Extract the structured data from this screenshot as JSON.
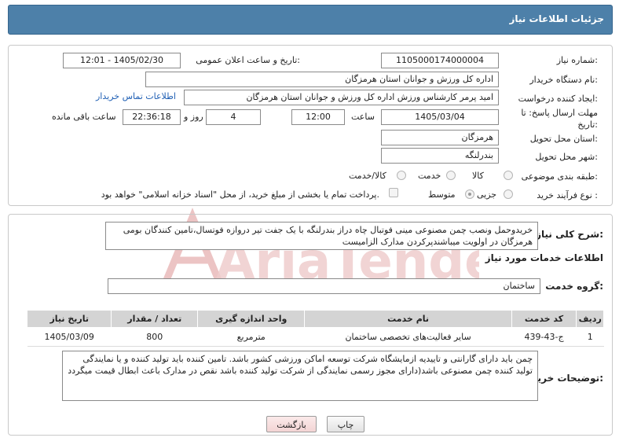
{
  "header": {
    "title": "جزئیات اطلاعات نیاز"
  },
  "form": {
    "need_number_label": "شماره نیاز:",
    "need_number": "1105000174000004",
    "announce_label": "تاریخ و ساعت اعلان عمومی:",
    "announce_value": "1405/02/30 - 12:01",
    "buyer_org_label": "نام دستگاه خریدار:",
    "buyer_org": "اداره کل ورزش و جوانان استان هرمزگان",
    "creator_label": "ایجاد کننده درخواست:",
    "creator": "امید پرمر کارشناس ورزش اداره کل ورزش و جوانان استان هرمزگان",
    "contact_link": "اطلاعات تماس خریدار",
    "deadline_label_1": "مهلت ارسال پاسخ: تا",
    "deadline_label_2": "تاریخ:",
    "deadline_date": "1405/03/04",
    "time_label": "ساعت",
    "deadline_time": "12:00",
    "days_value": "4",
    "days_label": "روز و",
    "remaining_time": "22:36:18",
    "remaining_label": "ساعت باقی مانده",
    "province_label": "استان محل تحویل:",
    "province": "هرمزگان",
    "city_label": "شهر محل تحویل:",
    "city": "بندرلنگه",
    "category_label": "طبقه بندی موضوعی:",
    "category_options": [
      "کالا",
      "خدمت",
      "کالا/خدمت"
    ],
    "process_label": "نوع فرآیند خرید :",
    "process_options": [
      "جزیی",
      "متوسط"
    ],
    "payment_note": "پرداخت تمام یا بخشی از مبلغ خرید، از محل \"اسناد خزانه اسلامی\" خواهد بود."
  },
  "description": {
    "label": "شرح کلی نیاز:",
    "text": "خریدوحمل ونصب چمن مصنوعی مینی فوتبال چاه دراز بندرلنگه با یک جفت تیر دروازه فوتسال،تامین کنندگان بومی هرمزگان در اولویت میباشندپرکردن مدارک الزامیست"
  },
  "services": {
    "section_title": "اطلاعات خدمات مورد نیاز",
    "group_label": "گروه خدمت:",
    "group_value": "ساختمان",
    "columns": [
      "ردیف",
      "کد خدمت",
      "نام خدمت",
      "واحد اندازه گیری",
      "تعداد / مقدار",
      "تاریخ نیاز"
    ],
    "rows": [
      [
        "1",
        "ج-43-439",
        "سایر فعالیت‌های تخصصی ساختمان",
        "مترمربع",
        "800",
        "1405/03/09"
      ]
    ]
  },
  "buyer_notes": {
    "label": "توضیحات خریدار:",
    "text": "چمن باید دارای گارانتی و تاییدیه ازمایشگاه شرکت توسعه اماکن ورزشی کشور باشد. تامین کننده باید تولید کننده و یا نمایندگی تولید کننده چمن مصنوعی باشد(دارای مجوز رسمی  نمایندگی از شرکت تولید کننده باشد نقص در مدارک باعث ابطال قیمت میگردد"
  },
  "buttons": {
    "print": "چاپ",
    "back": "بازگشت"
  },
  "watermark": {
    "text": "AriaTender.neT"
  },
  "colors": {
    "header_bg": "#4d80a9",
    "link": "#1f5fb4",
    "watermark": "#e8b3b3"
  }
}
